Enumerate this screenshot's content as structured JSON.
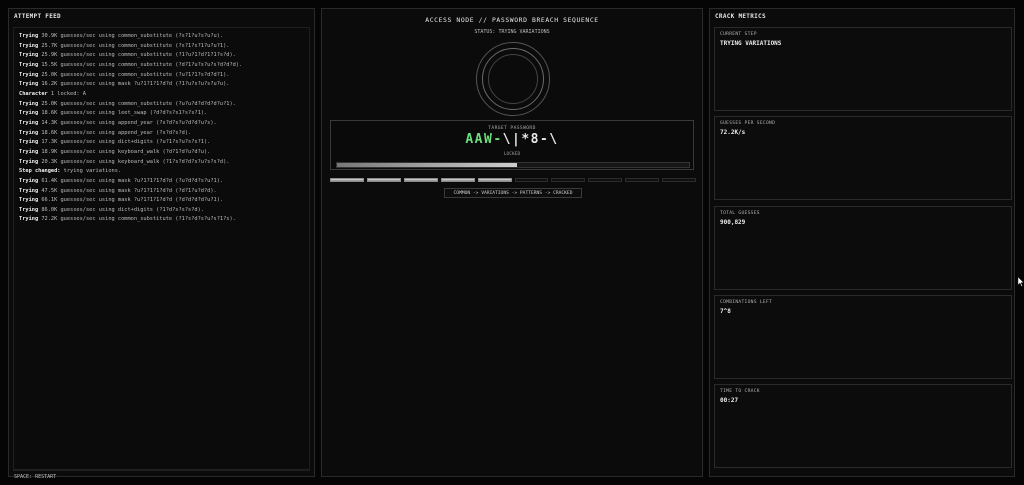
{
  "feed": {
    "title": "ATTEMPT FEED",
    "lines": [
      {
        "kw": "Trying",
        "text": "30.9K guesses/sec using common_substitute (?s?1?u?s?u?u)."
      },
      {
        "kw": "Trying",
        "text": "25.7K guesses/sec using common_substitute (?s?1?s?1?u?u?1)."
      },
      {
        "kw": "Trying",
        "text": "25.9K guesses/sec using common_substitute (?1?u?1?d?1?1?s?d)."
      },
      {
        "kw": "Trying",
        "text": "15.5K guesses/sec using common_substitute (?d?1?u?s?u?s?d?d?d)."
      },
      {
        "kw": "Trying",
        "text": "25.0K guesses/sec using common_substitute (?u?1?1?s?d?d?1)."
      },
      {
        "kw": "Trying",
        "text": "16.2K guesses/sec using mask ?u?1?1?1?d?d (?1?u?s?u?s?u?u)."
      },
      {
        "kw": "Character",
        "text": "1 locked: A"
      },
      {
        "kw": "Trying",
        "text": "25.0K guesses/sec using common_substitute (?u?u?d?d?d?d?u?1)."
      },
      {
        "kw": "Trying",
        "text": "18.6K guesses/sec using leet_swap (?d?d?s?s1?s?s?1)."
      },
      {
        "kw": "Trying",
        "text": "14.3K guesses/sec using append_year (?s?d?s?u?d?d?u?s)."
      },
      {
        "kw": "Trying",
        "text": "18.6K guesses/sec using append_year (?s?d?s?d)."
      },
      {
        "kw": "Trying",
        "text": "17.3K guesses/sec using dict+digits (?u?1?s?u?s?s?1)."
      },
      {
        "kw": "Trying",
        "text": "18.9K guesses/sec using keyboard_walk (?d?1?d?u?d?u)."
      },
      {
        "kw": "Trying",
        "text": "20.3K guesses/sec using keyboard_walk (?1?s?d?d?s?u?s?s?d)."
      },
      {
        "kw": "Step changed:",
        "text": "trying variations."
      },
      {
        "kw": "Trying",
        "text": "61.4K guesses/sec using mask ?u?1?1?1?d?d (?u?d?d?s?u?1)."
      },
      {
        "kw": "Trying",
        "text": "47.5K guesses/sec using mask ?u?1?1?1?d?d (?d?1?u?d?d)."
      },
      {
        "kw": "Trying",
        "text": "66.1K guesses/sec using mask ?u?1?1?1?d?d (?d?d?d?d?u?1)."
      },
      {
        "kw": "Trying",
        "text": "86.0K guesses/sec using dict+digits (?1?d?s?s?s?d)."
      },
      {
        "kw": "Trying",
        "text": "72.2K guesses/sec using common_substitute (?1?s?d?s?u?s?1?s)."
      }
    ],
    "footer": "SPACE: RESTART"
  },
  "center": {
    "header": "ACCESS NODE // PASSWORD BREACH SEQUENCE",
    "status": "STATUS: TRYING VARIATIONS",
    "password_label": "TARGET PASSWORD",
    "password_locked": "AAW-",
    "password_trying": "\\|*8-\\",
    "password_state": "LOCKED",
    "progress": 0.51,
    "steps_total": 10,
    "steps_done": 5,
    "pipeline": "COMMON -> VARIATIONS -> PATTERNS -> CRACKED"
  },
  "metrics": {
    "title": "CRACK METRICS",
    "items": [
      {
        "label": "CURRENT STEP",
        "value": "TRYING VARIATIONS"
      },
      {
        "label": "GUESSES PER SECOND",
        "value": "72.2K/s"
      },
      {
        "label": "TOTAL GUESSES",
        "value": "900,829"
      },
      {
        "label": "COMBINATIONS LEFT",
        "value": "7^8"
      },
      {
        "label": "TIME TO CRACK",
        "value": "00:27"
      }
    ]
  },
  "colors": {
    "background": "#050505",
    "panel": "#0b0b0b",
    "accent_green": "#6ddc7e"
  }
}
